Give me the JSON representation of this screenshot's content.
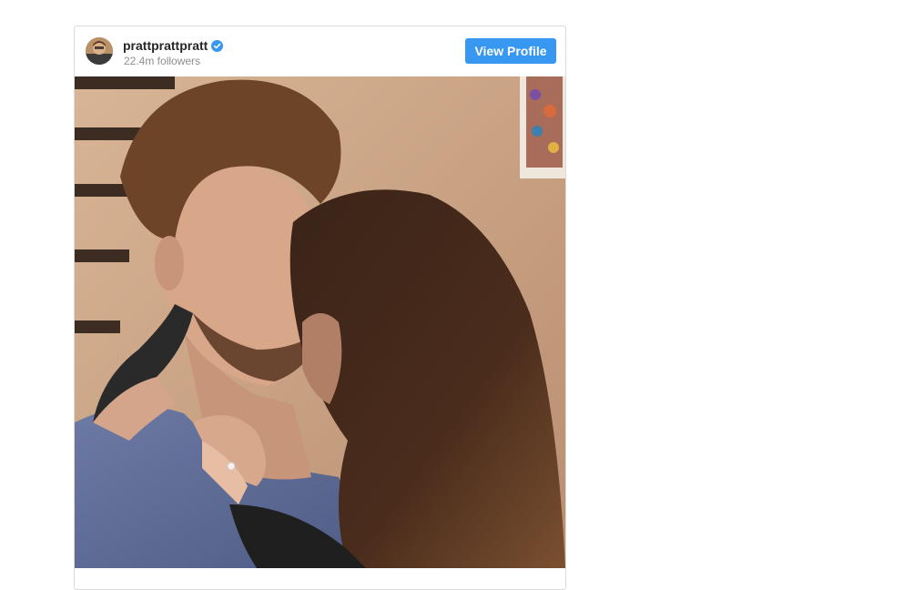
{
  "post": {
    "username": "prattprattpratt",
    "followers": "22.4m followers",
    "view_profile_label": "View Profile",
    "verified": true,
    "accent_color": "#3897f0",
    "photo_icon": "couple-embrace-photo"
  }
}
